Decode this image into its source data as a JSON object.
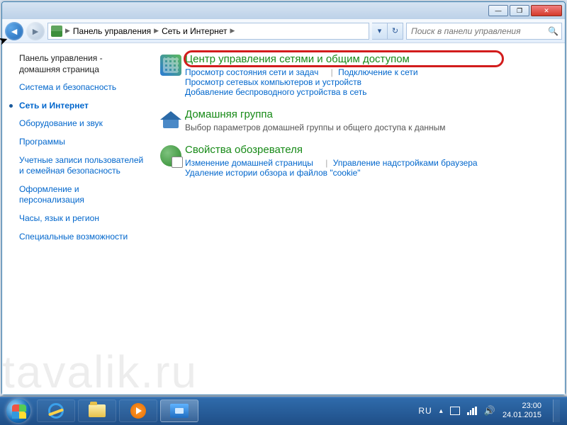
{
  "titlebar": {
    "minimize": "—",
    "maximize": "❐",
    "close": "✕"
  },
  "breadcrumb": {
    "items": [
      "Панель управления",
      "Сеть и Интернет"
    ]
  },
  "search": {
    "placeholder": "Поиск в панели управления"
  },
  "sidebar": {
    "home": "Панель управления - домашняя страница",
    "items": [
      "Система и безопасность",
      "Сеть и Интернет",
      "Оборудование и звук",
      "Программы",
      "Учетные записи пользователей и семейная безопасность",
      "Оформление и персонализация",
      "Часы, язык и регион",
      "Специальные возможности"
    ],
    "active_index": 1
  },
  "sections": [
    {
      "title": "Центр управления сетями и общим доступом",
      "links": [
        "Просмотр состояния сети и задач",
        "Подключение к сети",
        "Просмотр сетевых компьютеров и устройств",
        "Добавление беспроводного устройства в сеть"
      ],
      "link_groups": [
        [
          0,
          1
        ],
        [
          2
        ],
        [
          3
        ]
      ]
    },
    {
      "title": "Домашняя группа",
      "links": [
        "Выбор параметров домашней группы и общего доступа к данным"
      ],
      "link_groups": [
        [
          0
        ]
      ],
      "muted": true
    },
    {
      "title": "Свойства обозревателя",
      "links": [
        "Изменение домашней страницы",
        "Управление надстройками браузера",
        "Удаление истории обзора и файлов \"cookie\""
      ],
      "link_groups": [
        [
          0,
          1
        ],
        [
          2
        ]
      ]
    }
  ],
  "tray": {
    "lang": "RU",
    "time": "23:00",
    "date": "24.01.2015"
  },
  "watermark": "tavalik.ru"
}
